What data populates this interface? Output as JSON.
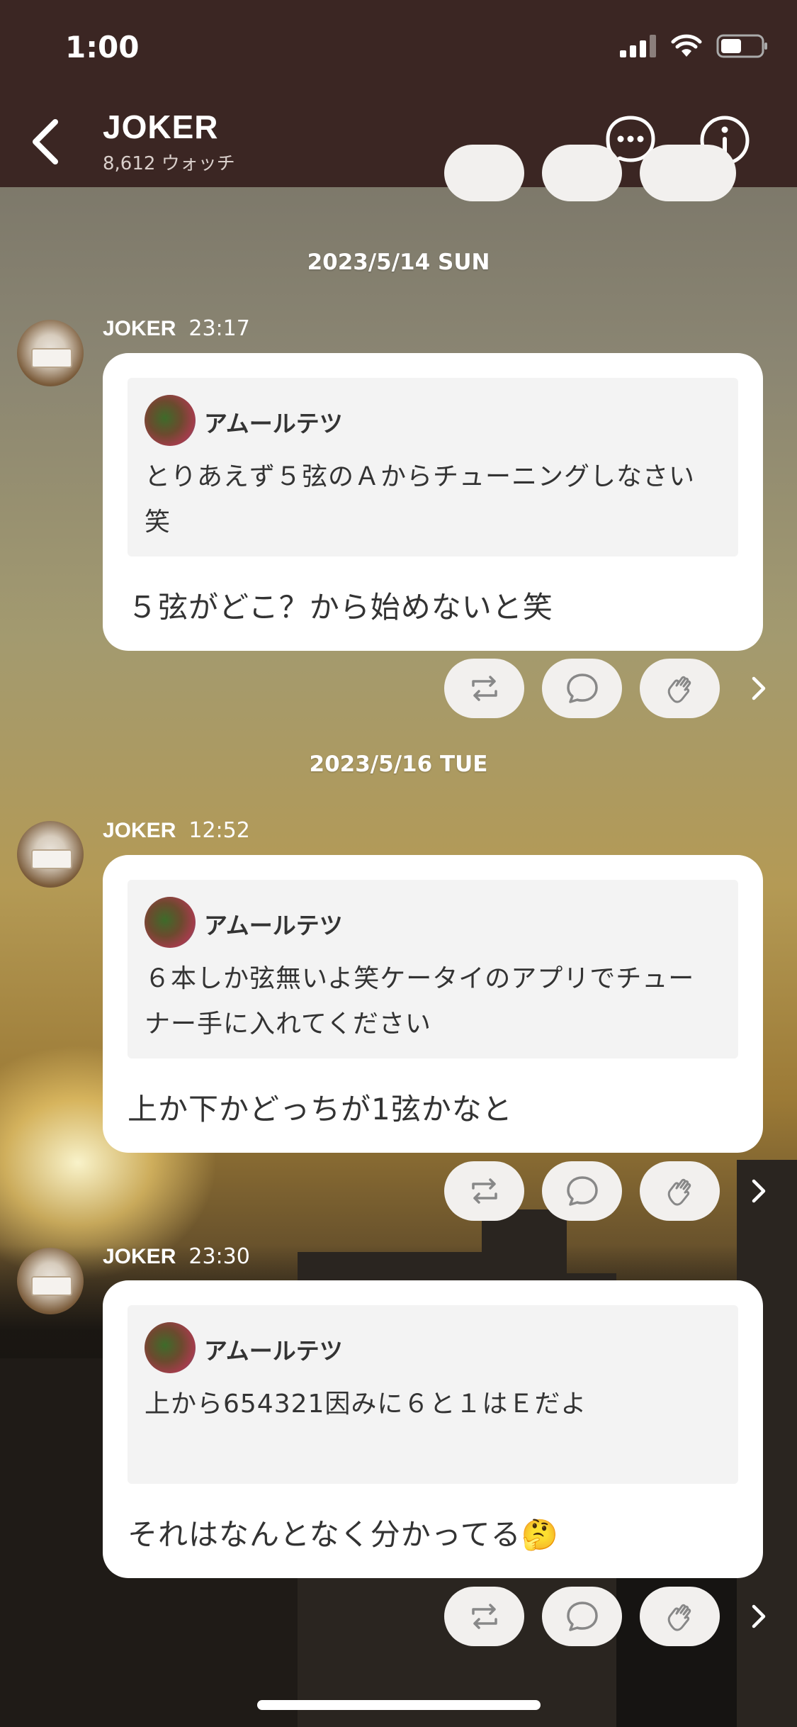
{
  "status": {
    "time": "1:00"
  },
  "header": {
    "title": "JOKER",
    "subtitle": "8,612 ウォッチ"
  },
  "icons": {
    "back": "chevron-left-icon",
    "chat": "chat-bubble-dots-icon",
    "info": "info-icon",
    "repost": "repost-icon",
    "comment": "comment-icon",
    "clap": "clap-icon",
    "more": "chevron-right-icon"
  },
  "feed": [
    {
      "date": "2023/5/14 SUN",
      "author": "JOKER",
      "time": "23:17",
      "quote_author": "アムールテツ",
      "quote_text": "とりあえず５弦のＡからチューニングしなさい笑",
      "text": "５弦がどこ？から始めないと笑"
    },
    {
      "date": "2023/5/16 TUE",
      "author": "JOKER",
      "time": "12:52",
      "quote_author": "アムールテツ",
      "quote_text": "６本しか弦無いよ笑ケータイのアプリでチューナー手に入れてください",
      "text": "上か下かどっちが1弦かなと"
    },
    {
      "author": "JOKER",
      "time": "23:30",
      "quote_author": "アムールテツ",
      "quote_text": "上から654321因みに６と１はＥだよ",
      "text": "それはなんとなく分かってる🤔"
    }
  ],
  "colors": {
    "header_bg": "#3b2623",
    "bubble_bg": "#ffffff",
    "quote_bg": "#f3f3f3"
  }
}
